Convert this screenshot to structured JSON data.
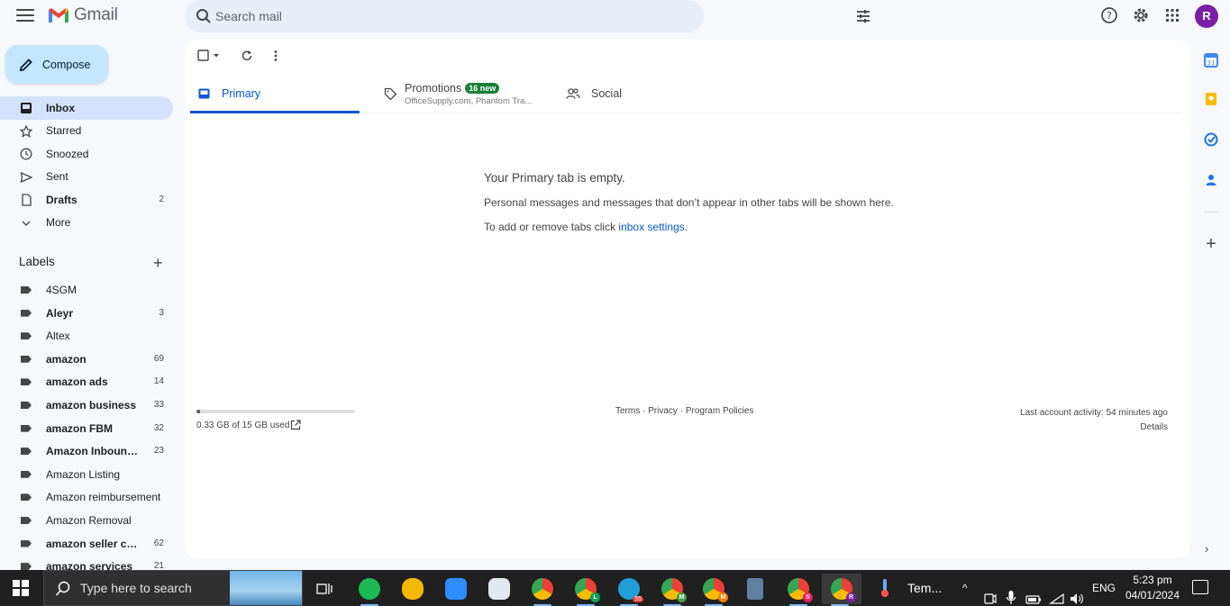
{
  "app": {
    "name": "Gmail"
  },
  "search": {
    "placeholder": "Search mail"
  },
  "account": {
    "avatar_letter": "R",
    "avatar_color": "#7b1fa2"
  },
  "compose": {
    "label": "Compose"
  },
  "nav": {
    "items": [
      {
        "label": "Inbox",
        "icon": "inbox-icon",
        "count": "",
        "active": true
      },
      {
        "label": "Starred",
        "icon": "star-icon",
        "count": ""
      },
      {
        "label": "Snoozed",
        "icon": "clock-icon",
        "count": ""
      },
      {
        "label": "Sent",
        "icon": "send-icon",
        "count": ""
      },
      {
        "label": "Drafts",
        "icon": "draft-icon",
        "count": "2"
      },
      {
        "label": "More",
        "icon": "chevron-down-icon",
        "count": ""
      }
    ]
  },
  "labels": {
    "header": "Labels",
    "items": [
      {
        "label": "4SGM",
        "count": ""
      },
      {
        "label": "Aleyr",
        "count": "3"
      },
      {
        "label": "Altex",
        "count": ""
      },
      {
        "label": "amazon",
        "count": "69"
      },
      {
        "label": "amazon ads",
        "count": "14"
      },
      {
        "label": "amazon business",
        "count": "33"
      },
      {
        "label": "amazon FBM",
        "count": "32"
      },
      {
        "label": "Amazon Inbound ...",
        "count": "23"
      },
      {
        "label": "Amazon Listing",
        "count": ""
      },
      {
        "label": "Amazon reimbursement",
        "count": ""
      },
      {
        "label": "Amazon Removal",
        "count": ""
      },
      {
        "label": "amazon seller cen...",
        "count": "62"
      },
      {
        "label": "amazon services",
        "count": "21"
      }
    ]
  },
  "tabs": {
    "primary": "Primary",
    "promotions": "Promotions",
    "promotions_badge": "16 new",
    "promotions_sub": "OfficeSupply.com, Phantom Tra...",
    "social": "Social"
  },
  "empty_state": {
    "title": "Your Primary tab is empty.",
    "line1": "Personal messages and messages that don’t appear in other tabs will be shown here.",
    "line2_prefix": "To add or remove tabs click ",
    "line2_link": "inbox settings",
    "line2_suffix": "."
  },
  "footer": {
    "storage_text": "0.33 GB of 15 GB used",
    "storage_fraction": 0.022,
    "terms": "Terms",
    "separator": "·",
    "privacy": "Privacy",
    "policies": "Program Policies",
    "activity": "Last account activity: 54 minutes ago",
    "details": "Details"
  },
  "taskbar": {
    "search_placeholder": "Type here to search",
    "telegram_badge": "55",
    "chrome_profiles": [
      "L",
      "M",
      "M",
      "S",
      "R"
    ],
    "temp_label": "Tem...",
    "language": "ENG",
    "time": "5:23 pm",
    "date": "04/01/2024"
  }
}
